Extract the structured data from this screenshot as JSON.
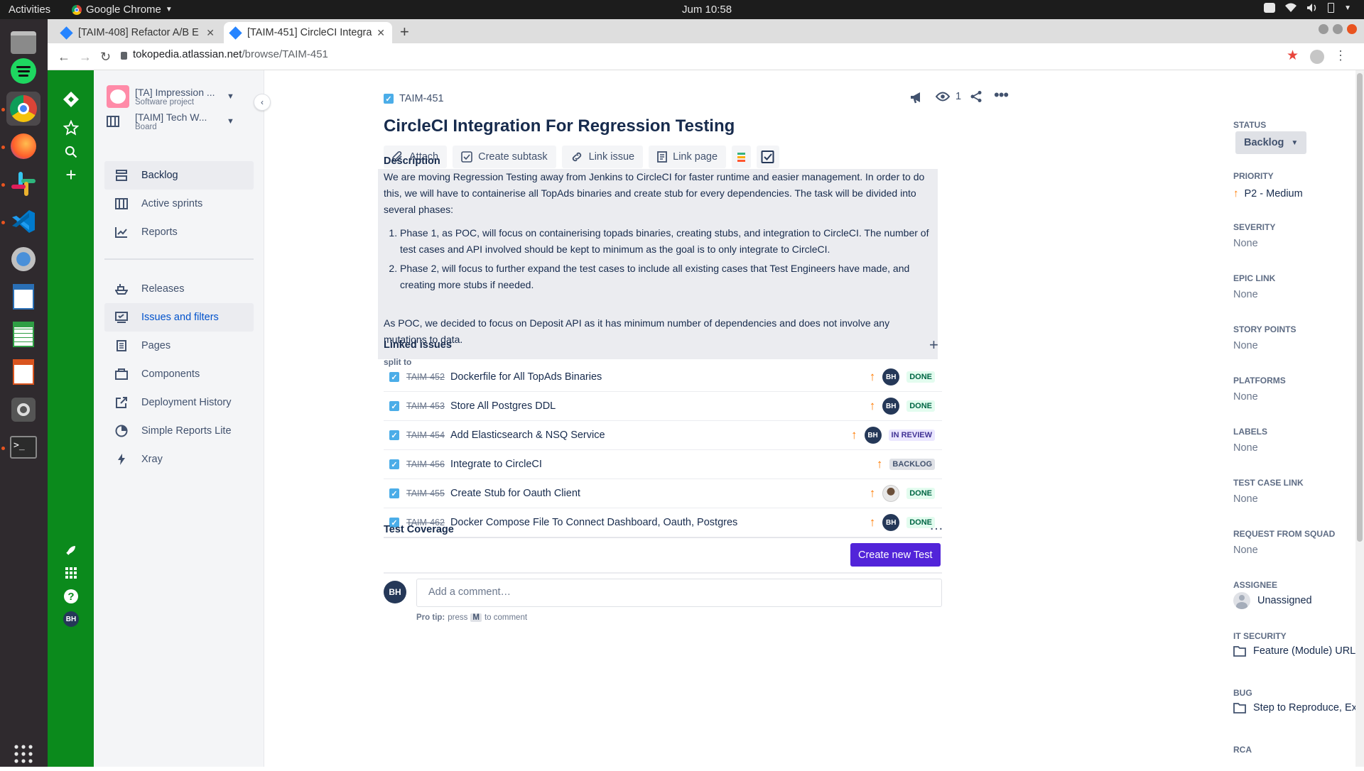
{
  "os": {
    "activities": "Activities",
    "app_name": "Google Chrome",
    "clock": "Jum 10:58"
  },
  "browser": {
    "tabs": [
      {
        "title": "[TAIM-408] Refactor A/B E"
      },
      {
        "title": "[TAIM-451] CircleCI Integra"
      }
    ],
    "url_host": "tokopedia.atlassian.net",
    "url_path": "/browse/TAIM-451"
  },
  "sidebar": {
    "project_name": "[TA] Impression ...",
    "project_type": "Software project",
    "board_name": "[TAIM] Tech W...",
    "board_type": "Board",
    "items": [
      {
        "label": "Backlog",
        "icon": "backlog-icon"
      },
      {
        "label": "Active sprints",
        "icon": "board-icon"
      },
      {
        "label": "Reports",
        "icon": "chart-icon"
      },
      {
        "label": "Releases",
        "icon": "ship-icon"
      },
      {
        "label": "Issues and filters",
        "icon": "issues-icon"
      },
      {
        "label": "Pages",
        "icon": "page-icon"
      },
      {
        "label": "Components",
        "icon": "box-icon"
      },
      {
        "label": "Deployment History",
        "icon": "external-icon"
      },
      {
        "label": "Simple Reports Lite",
        "icon": "pie-icon"
      },
      {
        "label": "Xray",
        "icon": "lightning-icon"
      }
    ]
  },
  "issue": {
    "key": "TAIM-451",
    "title": "CircleCI Integration For Regression Testing",
    "watchers": "1",
    "actions": {
      "attach": "Attach",
      "create_subtask": "Create subtask",
      "link_issue": "Link issue",
      "link_page": "Link page"
    },
    "description_heading": "Description",
    "description": {
      "intro": "We are moving Regression Testing away from Jenkins to CircleCI for faster runtime and easier management. In order to do this, we will have to containerise all TopAds binaries and create stub for every dependencies. The task will be divided into several phases:",
      "phases": [
        "Phase 1, as POC, will focus on containerising topads binaries, creating stubs, and integration to CircleCI. The number of test cases and API involved should be kept to minimum as the goal is to only integrate to CircleCI.",
        "Phase 2, will focus to further expand the test cases to include all existing cases that Test Engineers have made, and creating more stubs if needed."
      ],
      "outro": "As POC, we decided to focus on Deposit API as it has minimum number of dependencies and does not involve any mutations to data."
    },
    "linked_heading": "Linked issues",
    "link_type": "split to",
    "linked": [
      {
        "key": "TAIM-452",
        "summary": "Dockerfile for All TopAds Binaries",
        "assignee": "BH",
        "status": "DONE",
        "status_kind": "done"
      },
      {
        "key": "TAIM-453",
        "summary": "Store All Postgres DDL",
        "assignee": "BH",
        "status": "DONE",
        "status_kind": "done"
      },
      {
        "key": "TAIM-454",
        "summary": "Add Elasticsearch & NSQ Service",
        "assignee": "BH",
        "status": "IN REVIEW",
        "status_kind": "review"
      },
      {
        "key": "TAIM-456",
        "summary": "Integrate to CircleCI",
        "assignee": "",
        "status": "BACKLOG",
        "status_kind": "backlog"
      },
      {
        "key": "TAIM-455",
        "summary": "Create Stub for Oauth Client",
        "assignee": "photo",
        "status": "DONE",
        "status_kind": "done"
      },
      {
        "key": "TAIM-462",
        "summary": "Docker Compose File To Connect Dashboard, Oauth, Postgres",
        "assignee": "BH",
        "status": "DONE",
        "status_kind": "done"
      }
    ],
    "test_coverage_heading": "Test Coverage",
    "create_test_label": "Create new Test",
    "comment_avatar": "BH",
    "comment_placeholder": "Add a comment…",
    "pro_tip_label": "Pro tip:",
    "pro_tip_press": "press",
    "pro_tip_key": "M",
    "pro_tip_suffix": "to comment"
  },
  "details": {
    "status_label": "STATUS",
    "status_value": "Backlog",
    "priority_label": "PRIORITY",
    "priority_value": "P2 - Medium",
    "severity_label": "SEVERITY",
    "severity_value": "None",
    "epic_label": "EPIC LINK",
    "epic_value": "None",
    "story_points_label": "STORY POINTS",
    "story_points_value": "None",
    "platforms_label": "PLATFORMS",
    "platforms_value": "None",
    "labels_label": "LABELS",
    "labels_value": "None",
    "test_case_label": "TEST CASE LINK",
    "test_case_value": "None",
    "request_label": "REQUEST FROM SQUAD",
    "request_value": "None",
    "assignee_label": "ASSIGNEE",
    "assignee_value": "Unassigned",
    "it_security_label": "IT SECURITY",
    "it_security_value": "Feature (Module) URL, Header (CURL) Request, API ...",
    "bug_label": "BUG",
    "bug_value": "Step to Reproduce, Expected Result, Actual Test Re...",
    "rca_label": "RCA"
  },
  "colors": {
    "jira_nav": "#0b8a1c",
    "primary_button": "#5224d9",
    "priority_orange": "#ff7a00"
  },
  "global_nav_avatar": "BH"
}
